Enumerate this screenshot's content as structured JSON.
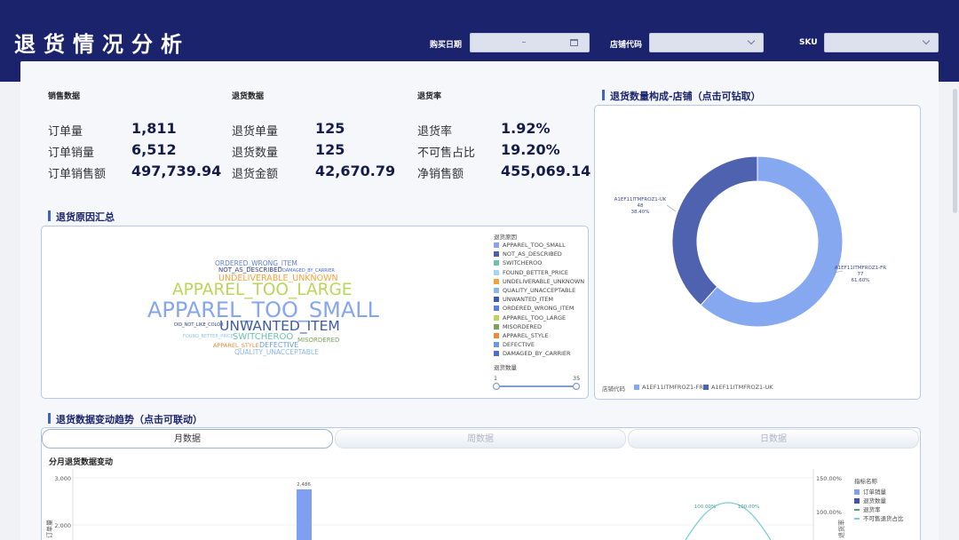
{
  "header": {
    "title": "退货情况分析",
    "filters": [
      {
        "label": "购买日期",
        "value": ""
      },
      {
        "label": "店铺代码",
        "value": ""
      },
      {
        "label": "SKU",
        "value": ""
      }
    ]
  },
  "kpis": {
    "sales": {
      "heading": "销售数据",
      "items": [
        {
          "label": "订单量",
          "value": "1,811"
        },
        {
          "label": "订单销量",
          "value": "6,512"
        },
        {
          "label": "订单销售额",
          "value": "497,739.94"
        }
      ]
    },
    "returns": {
      "heading": "退货数据",
      "items": [
        {
          "label": "退货单量",
          "value": "125"
        },
        {
          "label": "退货数量",
          "value": "125"
        },
        {
          "label": "退货金额",
          "value": "42,670.79"
        }
      ]
    },
    "rate": {
      "heading": "退货率",
      "items": [
        {
          "label": "退货率",
          "value": "1.92%"
        },
        {
          "label": "不可售占比",
          "value": "19.20%"
        },
        {
          "label": "净销售额",
          "value": "455,069.14"
        }
      ]
    }
  },
  "reasons": {
    "title": "退货原因汇总",
    "words": [
      {
        "text": "ORDERED_WRONG_ITEM",
        "color": "#5a7fd6"
      },
      {
        "text": "NOT_AS_DESCRIBED",
        "color": "#2f418a"
      },
      {
        "text": "DAMAGED_BY_CARRIER",
        "color": "#4a6fd0"
      },
      {
        "text": "UNDELIVERABLE_UNKNOWN",
        "color": "#f2a33a"
      },
      {
        "text": "APPAREL_TOO_LARGE",
        "color": "#b9d65a"
      },
      {
        "text": "APPAREL_TOO_SMALL",
        "color": "#85a6ef"
      },
      {
        "text": "DID_NOT_LIKE_COLOR",
        "color": "#2f418a"
      },
      {
        "text": "UNWANTED_ITEM",
        "color": "#3f5aa8"
      },
      {
        "text": "FOUND_BETTER_PRICE",
        "color": "#8ec4ef"
      },
      {
        "text": "SWITCHEROO",
        "color": "#6cc2ad"
      },
      {
        "text": "MISORDERED",
        "color": "#7ba35a"
      },
      {
        "text": "APPAREL_STYLE",
        "color": "#f08a3a"
      },
      {
        "text": "DEFECTIVE",
        "color": "#6a9be0"
      },
      {
        "text": "QUALITY_UNACCEPTABLE",
        "color": "#8ab8e8"
      }
    ],
    "legend_title": "退货原因",
    "legend": [
      {
        "text": "APPAREL_TOO_SMALL",
        "color": "#85a6ef"
      },
      {
        "text": "NOT_AS_DESCRIBED",
        "color": "#4b5fa8"
      },
      {
        "text": "SWITCHEROO",
        "color": "#6cc2ad"
      },
      {
        "text": "FOUND_BETTER_PRICE",
        "color": "#a7d6f2"
      },
      {
        "text": "UNDELIVERABLE_UNKNOWN",
        "color": "#f2a33a"
      },
      {
        "text": "QUALITY_UNACCEPTABLE",
        "color": "#8ab8e8"
      },
      {
        "text": "UNWANTED_ITEM",
        "color": "#3f5aa8"
      },
      {
        "text": "ORDERED_WRONG_ITEM",
        "color": "#5a7fd6"
      },
      {
        "text": "APPAREL_TOO_LARGE",
        "color": "#b9d65a"
      },
      {
        "text": "MISORDERED",
        "color": "#7ba35a"
      },
      {
        "text": "APPAREL_STYLE",
        "color": "#f08a3a"
      },
      {
        "text": "DEFECTIVE",
        "color": "#6a9be0"
      },
      {
        "text": "DAMAGED_BY_CARRIER",
        "color": "#4a6fd0"
      }
    ],
    "size_legend_title": "退货数量",
    "size_min": "1",
    "size_max": "35"
  },
  "store_share": {
    "title": "退货数量构成-店铺（点击可钻取）",
    "legend_title": "店铺代码",
    "chart_data": {
      "type": "pie",
      "donut": true,
      "slices": [
        {
          "name": "A1EF11ITMFROZ1-FR",
          "value": 77,
          "percent": "61.60%",
          "color": "#86a8f0"
        },
        {
          "name": "A1EF11ITMFROZ1-UK",
          "value": 48,
          "percent": "38.40%",
          "color": "#4f62b0"
        }
      ]
    }
  },
  "trend": {
    "title": "退货数据变动趋势（点击可联动）",
    "tabs": [
      "月数据",
      "周数据",
      "日数据"
    ],
    "active_tab": 0,
    "chart_title": "分月退货数据变动",
    "chart_data": {
      "type": "bar",
      "y_left_ticks": [
        "3,000",
        "2,000"
      ],
      "y_left_label": "订单量",
      "y_right_ticks": [
        "150.00%",
        "100.00%"
      ],
      "y_right_label": "退货率",
      "bar_label": "2,486",
      "rate_labels": [
        "100.00%",
        "100.00%"
      ],
      "legend_title": "指标名称",
      "legend": [
        {
          "name": "订单销量",
          "color": "#7f9ff0",
          "kind": "bar"
        },
        {
          "name": "退货数量",
          "color": "#3f55a8",
          "kind": "bar"
        },
        {
          "name": "退货率",
          "color": "#5a9b7a",
          "kind": "line"
        },
        {
          "name": "不可售退货占比",
          "color": "#7cd0d6",
          "kind": "line"
        }
      ]
    }
  }
}
